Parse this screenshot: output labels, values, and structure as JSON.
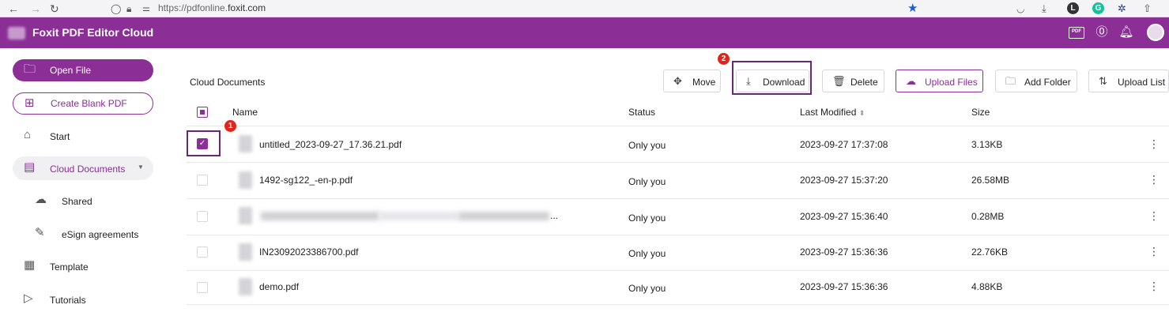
{
  "browser": {
    "url_prefix": "https://pdfonline.",
    "url_domain": "foxit.com"
  },
  "header": {
    "app_title": "Foxit PDF Editor Cloud",
    "pdf_badge": "PDF"
  },
  "sidebar": {
    "open_file": "Open File",
    "create_blank": "Create Blank PDF",
    "items": [
      {
        "label": "Start"
      },
      {
        "label": "Cloud Documents"
      },
      {
        "label": "Shared"
      },
      {
        "label": "eSign agreements"
      },
      {
        "label": "Template"
      },
      {
        "label": "Tutorials"
      }
    ]
  },
  "main": {
    "title": "Cloud Documents",
    "toolbar": {
      "move": "Move",
      "download": "Download",
      "delete": "Delete",
      "upload_files": "Upload Files",
      "add_folder": "Add Folder",
      "upload_list": "Upload List"
    },
    "annotations": {
      "badge_1": "1",
      "badge_2": "2"
    },
    "columns": {
      "name": "Name",
      "status": "Status",
      "last_modified": "Last Modified",
      "size": "Size"
    },
    "rows": [
      {
        "name": "untitled_2023-09-27_17.36.21.pdf",
        "status": "Only you",
        "modified": "2023-09-27 17:37:08",
        "size": "3.13KB",
        "checked": true
      },
      {
        "name": "1492-sg122_-en-p.pdf",
        "status": "Only you",
        "modified": "2023-09-27 15:37:20",
        "size": "26.58MB",
        "checked": false
      },
      {
        "name": "...",
        "status": "Only you",
        "modified": "2023-09-27 15:36:40",
        "size": "0.28MB",
        "checked": false
      },
      {
        "name": "IN23092023386700.pdf",
        "status": "Only you",
        "modified": "2023-09-27 15:36:36",
        "size": "22.76KB",
        "checked": false
      },
      {
        "name": "demo.pdf",
        "status": "Only you",
        "modified": "2023-09-27 15:36:36",
        "size": "4.88KB",
        "checked": false
      }
    ]
  },
  "colors": {
    "brand": "#8b2f97",
    "annotation_badge": "#e0251b",
    "annotation_box": "#6a2775"
  }
}
